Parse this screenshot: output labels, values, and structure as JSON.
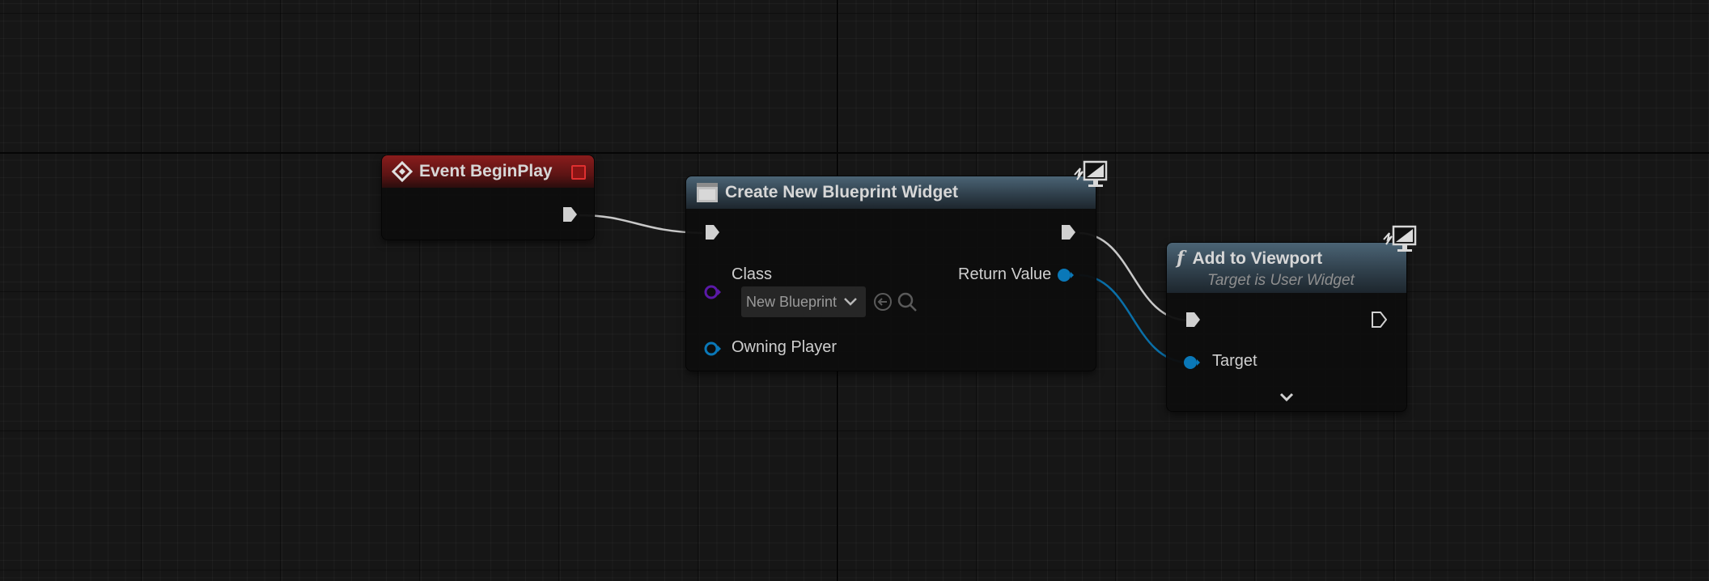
{
  "nodes": {
    "event_begin_play": {
      "title": "Event BeginPlay",
      "header_color": "#8a1c1c"
    },
    "create_widget": {
      "title": "Create New Blueprint Widget",
      "header_color": "#4b6475",
      "class_label": "Class",
      "class_value": "New Blueprint",
      "return_label": "Return Value",
      "owning_label": "Owning Player"
    },
    "add_to_viewport": {
      "title": "Add to Viewport",
      "subtitle": "Target is User Widget",
      "header_color": "#4b6475",
      "target_label": "Target"
    }
  },
  "colors": {
    "exec_wire": "#c8c8c8",
    "object_wire": "#0a6fa8",
    "class_pin": "#5b19a8",
    "object_pin": "#0a78b8"
  },
  "icons": {
    "event": "event-diamond-icon",
    "widget": "widget-icon",
    "function": "function-f-icon",
    "monitor": "monitor-lightning-icon",
    "browse": "browse-arrow-icon",
    "search": "search-icon",
    "expand": "chevron-down-icon"
  }
}
